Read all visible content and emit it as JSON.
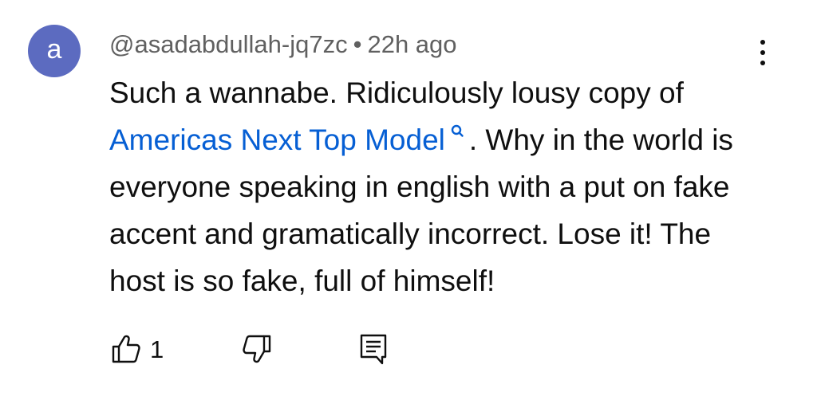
{
  "comment": {
    "avatar_letter": "a",
    "avatar_color": "#5c6bc0",
    "author": "@asadabdullah-jq7zc",
    "separator": "•",
    "time": "22h ago",
    "text_before": "Such a wannabe. Ridiculously lousy copy of ",
    "link_text": "Americas Next Top Model",
    "link_icon": "search-icon",
    "text_after": ". Why in the world is everyone speaking in english with a put on fake accent and gramatically incorrect. Lose it! The host is so fake, full of himself!",
    "like_count": "1",
    "link_color": "#065fd4",
    "meta_color": "#606060"
  },
  "actions": {
    "like_icon": "thumbs-up-icon",
    "dislike_icon": "thumbs-down-icon",
    "reply_icon": "reply-icon",
    "menu_icon": "more-vertical-icon"
  }
}
